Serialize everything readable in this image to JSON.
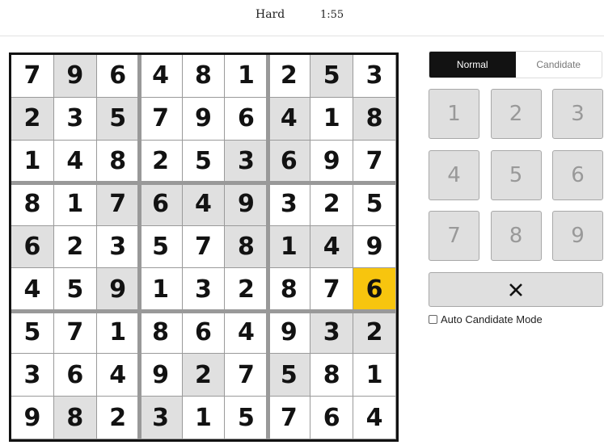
{
  "header": {
    "difficulty": "Hard",
    "timer": "1:55"
  },
  "board": {
    "cells": [
      [
        7,
        9,
        6,
        4,
        8,
        1,
        2,
        5,
        3
      ],
      [
        2,
        3,
        5,
        7,
        9,
        6,
        4,
        1,
        8
      ],
      [
        1,
        4,
        8,
        2,
        5,
        3,
        6,
        9,
        7
      ],
      [
        8,
        1,
        7,
        6,
        4,
        9,
        3,
        2,
        5
      ],
      [
        6,
        2,
        3,
        5,
        7,
        8,
        1,
        4,
        9
      ],
      [
        4,
        5,
        9,
        1,
        3,
        2,
        8,
        7,
        6
      ],
      [
        5,
        7,
        1,
        8,
        6,
        4,
        9,
        3,
        2
      ],
      [
        3,
        6,
        4,
        9,
        2,
        7,
        5,
        8,
        1
      ],
      [
        9,
        8,
        2,
        3,
        1,
        5,
        7,
        6,
        4
      ]
    ],
    "shaded": [
      [
        0,
        1
      ],
      [
        0,
        7
      ],
      [
        1,
        0
      ],
      [
        1,
        2
      ],
      [
        1,
        6
      ],
      [
        1,
        8
      ],
      [
        2,
        5
      ],
      [
        2,
        6
      ],
      [
        3,
        2
      ],
      [
        3,
        3
      ],
      [
        3,
        4
      ],
      [
        3,
        5
      ],
      [
        4,
        0
      ],
      [
        4,
        5
      ],
      [
        4,
        6
      ],
      [
        4,
        7
      ],
      [
        5,
        2
      ],
      [
        6,
        7
      ],
      [
        6,
        8
      ],
      [
        7,
        4
      ],
      [
        7,
        6
      ],
      [
        8,
        1
      ],
      [
        8,
        3
      ]
    ],
    "selected": [
      5,
      8
    ],
    "colors": {
      "shaded": "#e0e0e0",
      "selected": "#f7c50e",
      "border": "#121212",
      "block_line": "#999999"
    }
  },
  "controls": {
    "modes": [
      {
        "label": "Normal",
        "active": true
      },
      {
        "label": "Candidate",
        "active": false
      }
    ],
    "numbers": [
      "1",
      "2",
      "3",
      "4",
      "5",
      "6",
      "7",
      "8",
      "9"
    ],
    "erase_icon": "close-x-icon",
    "auto_candidate_label": "Auto Candidate Mode",
    "auto_candidate_checked": false
  }
}
